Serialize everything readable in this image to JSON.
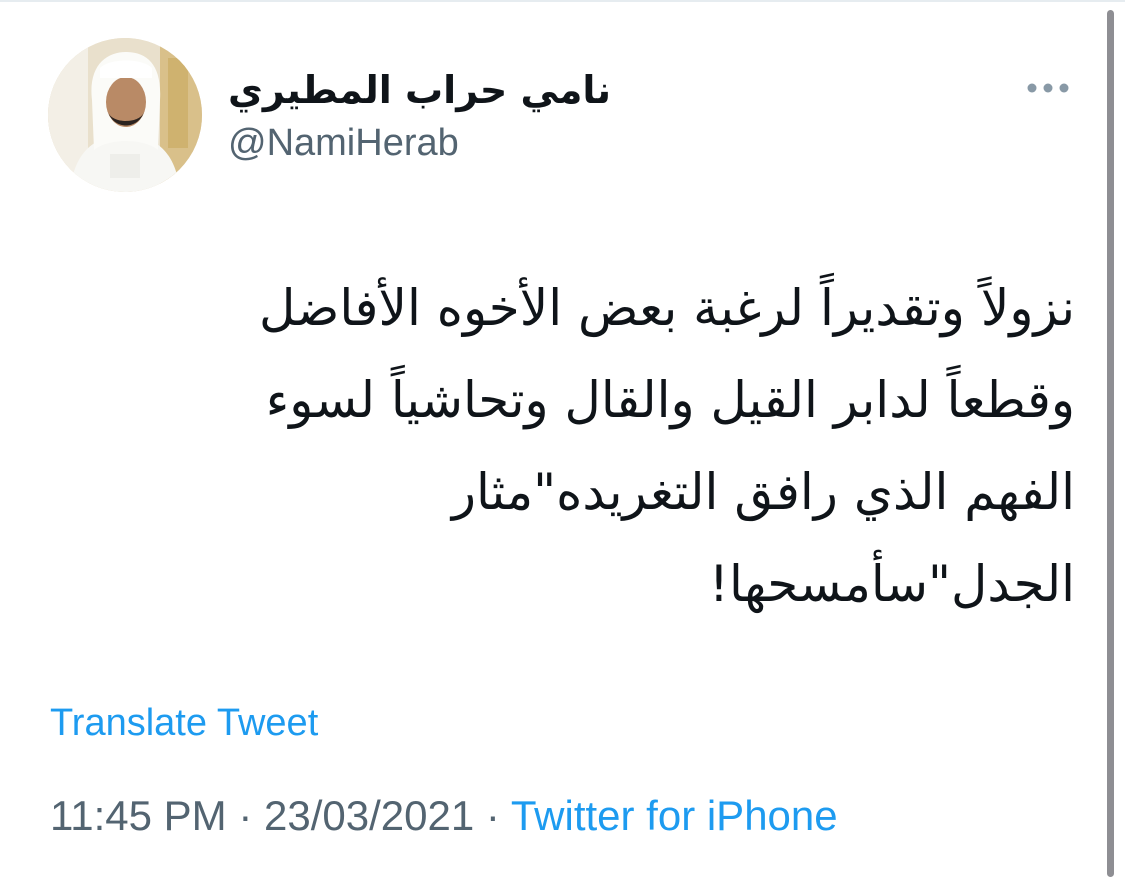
{
  "tweet": {
    "author": {
      "display_name": "نامي حراب المطيري",
      "handle": "@NamiHerab"
    },
    "text": "نزولاً وتقديراً لرغبة بعض الأخوه الأفاضل\nوقطعاً لدابر القيل والقال وتحاشياً لسوء\nالفهم الذي رافق التغريده\"مثار\nالجدل\"سأمسحها!",
    "translate_label": "Translate Tweet",
    "time": "11:45 PM",
    "separator": "·",
    "date": "23/03/2021",
    "source": "Twitter for iPhone"
  },
  "icons": {
    "more": "more-horizontal-icon",
    "avatar": "profile-photo"
  },
  "colors": {
    "link": "#1d9bf0",
    "text": "#0f1419",
    "secondary": "#536471"
  }
}
